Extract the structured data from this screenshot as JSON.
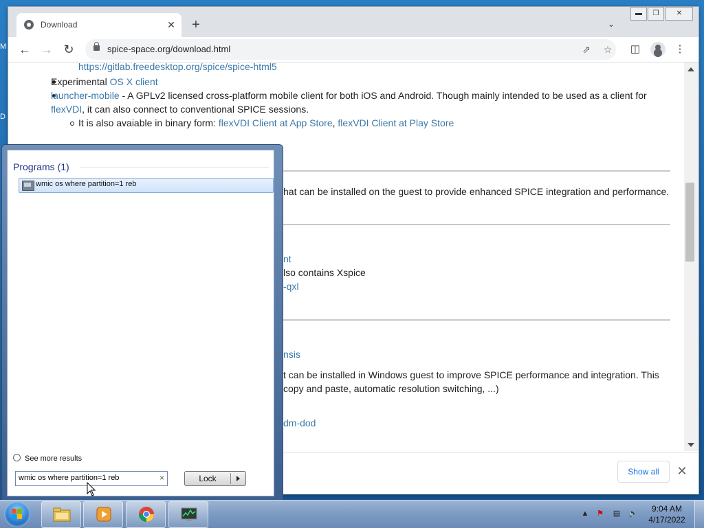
{
  "desktop": {
    "fragments": [
      "M",
      "D"
    ]
  },
  "browser": {
    "tab_title": "Download",
    "tab_close": "✕",
    "new_tab": "+",
    "url": "spice-space.org/download.html",
    "window_controls": {
      "minimize": "▬",
      "restore": "❐",
      "close": "✕"
    }
  },
  "page": {
    "top_cut_link": "https://gitlab.freedesktop.org/spice/spice-html5",
    "osx_prefix": "Experimental ",
    "osx_link": "OS X client",
    "launcher_link": "launcher-mobile",
    "launcher_text": " - A GPLv2 licensed cross-platform mobile client for both iOS and Android. Though mainly intended to be used as a client for",
    "flexvdi_link": "flexVDI",
    "flexvdi_text": ", it can also connect to conventional SPICE sessions.",
    "binary_text": "It is also avaiable in binary form: ",
    "appstore_link": "flexVDI Client at App Store",
    "comma": ", ",
    "playstore_link": "flexVDI Client at Play Store",
    "guest_text": "hat can be installed on the guest to provide enhanced SPICE integration and performance.",
    "frag_nt": "nt",
    "frag_xspice": "lso contains Xspice",
    "frag_qxl": "-qxl",
    "frag_nsis": "nsis",
    "frag_windows": "t can be installed in Windows guest to improve SPICE performance and integration. This",
    "frag_copy": "copy and paste, automatic resolution switching, ...)",
    "frag_dod": "dm-dod"
  },
  "downloads": {
    "show_all": "Show all",
    "close": "✕"
  },
  "start_menu": {
    "heading": "Programs (1)",
    "result_label": "wmic os where partition=1 reb",
    "see_more": "See more results",
    "search_value": "wmic os where partition=1 reb",
    "clear": "×",
    "lock_label": "Lock"
  },
  "taskbar": {
    "time": "9:04 AM",
    "date": "4/17/2022"
  },
  "colors": {
    "link": "#3a78a8",
    "accent": "#1a73e8",
    "taskbar": "#7e9cc4"
  }
}
